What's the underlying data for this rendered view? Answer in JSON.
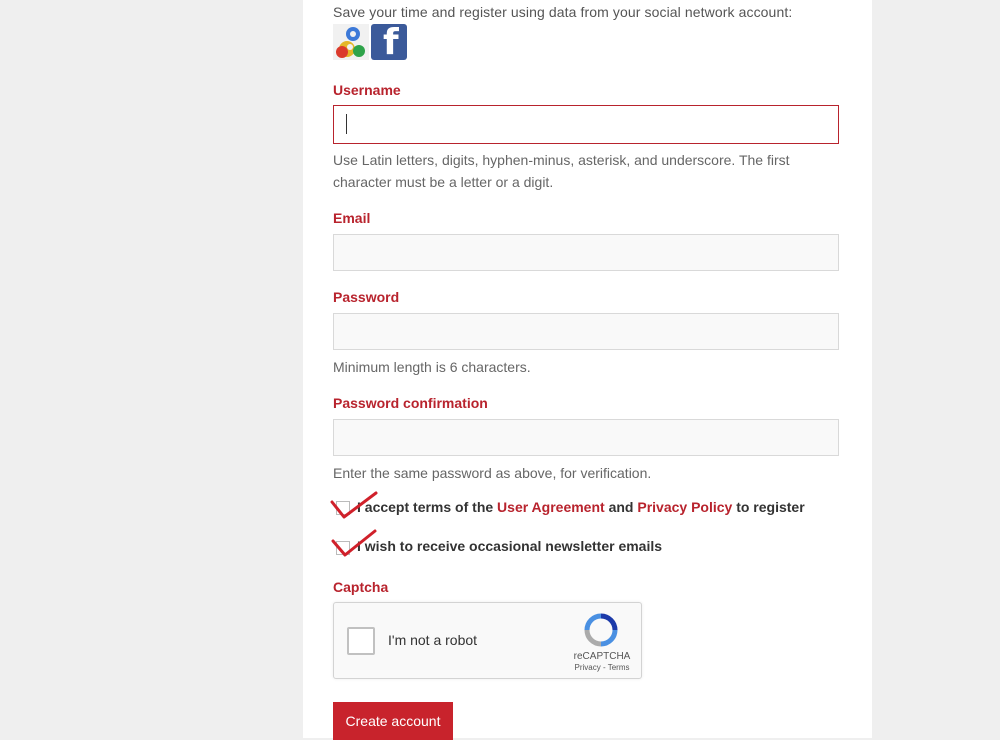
{
  "social": {
    "intro": "Save your time and register using data from your social network account:",
    "google_icon": "google-icon",
    "facebook_icon": "facebook-icon",
    "facebook_glyph": "f"
  },
  "username": {
    "label": "Username",
    "value": "",
    "hint": "Use Latin letters, digits, hyphen-minus, asterisk, and underscore. The first character must be a letter or a digit."
  },
  "email": {
    "label": "Email",
    "value": ""
  },
  "password": {
    "label": "Password",
    "value": "",
    "hint": "Minimum length is 6 characters."
  },
  "password_confirmation": {
    "label": "Password confirmation",
    "value": "",
    "hint": "Enter the same password as above, for verification."
  },
  "terms": {
    "pre": "I accept terms of the ",
    "user_agreement": "User Agreement",
    "and": " and ",
    "privacy_policy": "Privacy Policy",
    "post": " to register"
  },
  "newsletter": {
    "label": "I wish to receive occasional newsletter emails"
  },
  "captcha": {
    "label": "Captcha",
    "checkbox_text": "I'm not a robot",
    "brand": "reCAPTCHA",
    "links": "Privacy - Terms"
  },
  "submit": {
    "label": "Create account"
  },
  "colors": {
    "accent": "#b8232d",
    "button": "#c8232c",
    "annotation": "#d0202a"
  }
}
